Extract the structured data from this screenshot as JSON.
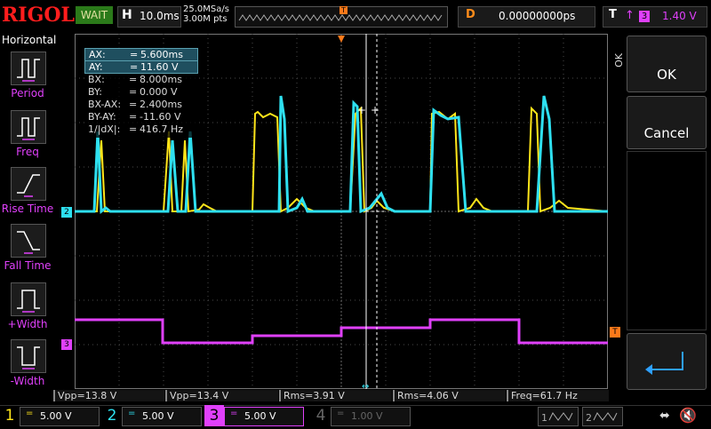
{
  "top": {
    "logo": "RIGOL",
    "run_state": "WAIT",
    "timebase_key": "H",
    "timebase": "10.0ms",
    "sample_rate": "25.0MSa/s",
    "memory_depth": "3.00M pts",
    "delay_key": "D",
    "delay": "0.00000000ps",
    "trigger_key": "T",
    "trigger_source": "3",
    "trigger_level": "1.40 V",
    "trigger_pos_marker": "T"
  },
  "left_menu": {
    "title": "Horizontal",
    "items": [
      {
        "label": "Period"
      },
      {
        "label": "Freq"
      },
      {
        "label": "Rise Time"
      },
      {
        "label": "Fall Time"
      },
      {
        "label": "+Width"
      },
      {
        "label": "-Width"
      }
    ]
  },
  "right_panel": {
    "ok_tab": "OK",
    "ok": "OK",
    "cancel": "Cancel"
  },
  "cursor": {
    "rows": [
      {
        "name": "AX:",
        "eq": "=",
        "value": "5.600ms",
        "highlight": true
      },
      {
        "name": "AY:",
        "eq": "=",
        "value": "11.60 V",
        "highlight": true
      },
      {
        "name": "BX:",
        "eq": "=",
        "value": "8.000ms",
        "highlight": false
      },
      {
        "name": "BY:",
        "eq": "=",
        "value": "0.000 V",
        "highlight": false
      },
      {
        "name": "BX-AX:",
        "eq": "=",
        "value": "2.400ms",
        "highlight": false
      },
      {
        "name": "BY-AY:",
        "eq": "=",
        "value": "-11.60 V",
        "highlight": false
      },
      {
        "name": "1/|dX|:",
        "eq": "=",
        "value": "416.7 Hz",
        "highlight": false
      }
    ]
  },
  "measurements": [
    {
      "text": "Vpp=13.8 V",
      "color": "#ffe51a"
    },
    {
      "text": "Vpp=13.4 V",
      "color": "#2ee0f0"
    },
    {
      "text": "Rms=3.91 V",
      "color": "#e040fb"
    },
    {
      "text": "Rms=4.06 V",
      "color": "#2ee0f0"
    },
    {
      "text": "Freq=61.7 Hz",
      "color": "#ffe51a"
    }
  ],
  "channels": [
    {
      "num": "1",
      "coupling": "=",
      "scale": "5.00 V",
      "color": "#ffe51a"
    },
    {
      "num": "2",
      "coupling": "=",
      "scale": "5.00 V",
      "color": "#2ee0f0"
    },
    {
      "num": "3",
      "coupling": "=",
      "scale": "5.00 V",
      "color": "#e040fb"
    },
    {
      "num": "4",
      "coupling": "=",
      "scale": "1.00 V",
      "color": "#666666"
    }
  ],
  "markers": {
    "ch2": "2",
    "ch3": "3",
    "trig_level": "T"
  },
  "colors": {
    "ch1": "#ffe51a",
    "ch2": "#2ee0f0",
    "ch3": "#e040fb",
    "trigger": "#ff7a1a",
    "grid": "#5a5a5a"
  }
}
